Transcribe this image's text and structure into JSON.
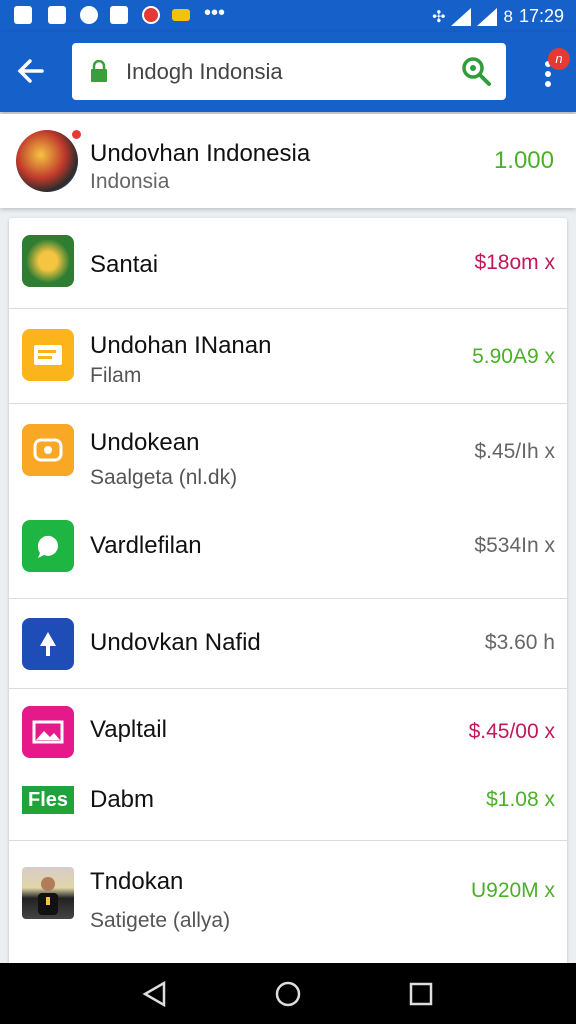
{
  "status_bar": {
    "time": "17:29",
    "battery": "8"
  },
  "app_bar": {
    "search_text": "Indogh Indonsia",
    "notification_badge": "n"
  },
  "header": {
    "title": "Undovhan Indonesia",
    "subtitle": "Indonsia",
    "value": "1.000"
  },
  "items": [
    {
      "title": "Santai",
      "subtitle": "",
      "price": "$18om x",
      "price_color": "#c2185b"
    },
    {
      "title": "Undohan INanan",
      "subtitle": "Filam",
      "price": "5.90A9 x",
      "price_color": "#4caf2a"
    },
    {
      "title": "Undokean",
      "subtitle": "Saalgeta (nl.dk)",
      "price": "$.45/Ih x",
      "price_color": "#666666"
    },
    {
      "title": "Vardlefilan",
      "subtitle": "",
      "price": "$534In x",
      "price_color": "#666666"
    },
    {
      "title": "Undovkan Nafid",
      "subtitle": "",
      "price": "$3.60 h",
      "price_color": "#666666"
    },
    {
      "title": "Vapltail",
      "subtitle": "",
      "price": "$.45/00 x",
      "price_color": "#c2185b"
    },
    {
      "title": "Dabm",
      "subtitle": "",
      "price": "$1.08 x",
      "price_color": "#4caf2a"
    },
    {
      "title": "Tndokan",
      "subtitle": "Satigete (allya)",
      "price": "U920M x",
      "price_color": "#4caf2a"
    }
  ],
  "icons": {
    "item_0": "emblem-icon",
    "item_1": "document-icon",
    "item_2": "gift-icon",
    "item_3": "chat-icon",
    "item_4": "navigation-icon",
    "item_5": "image-icon",
    "item_6": "files-icon",
    "item_7": "person-photo-icon"
  },
  "icon_labels": {
    "files": "Fles"
  }
}
